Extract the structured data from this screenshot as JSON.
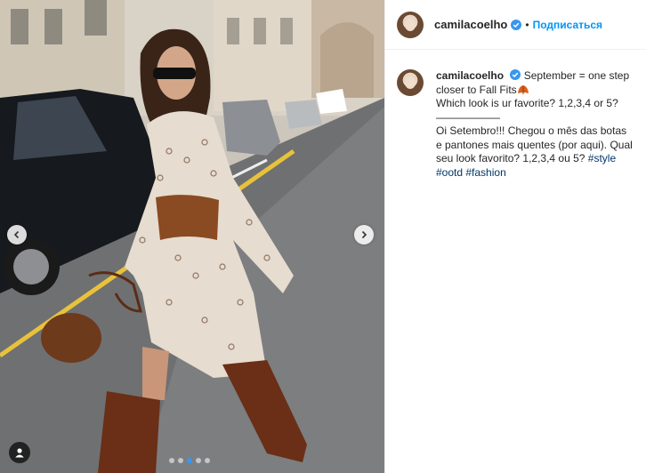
{
  "post": {
    "username": "camilacoelho",
    "verified": true,
    "separator": "•",
    "follow_label": "Подписаться"
  },
  "caption": {
    "username": "camilacoelho",
    "line1": "September = one step closer to Fall Fits",
    "line2": "Which look is ur favorite? 1,2,3,4 or 5?",
    "divider": "——————",
    "line3": "Oi Setembro!!! Chegou o mês das botas e pantones mais quentes (por aqui). Qual seu look favorito? 1,2,3,4 ou 5?",
    "hashtags": [
      "#style",
      "#ootd",
      "#fashion"
    ]
  },
  "carousel": {
    "slides": 5,
    "active_index": 2
  },
  "icons": {
    "prev": "chevron-left-icon",
    "next": "chevron-right-icon",
    "tags": "user-tag-icon",
    "verified": "verified-badge-icon",
    "emoji": "autumn-leaf-icon"
  },
  "colors": {
    "follow": "#0095f6",
    "hashtag": "#00376b",
    "verified": "#3897f0",
    "active_dot": "#3897f0"
  }
}
